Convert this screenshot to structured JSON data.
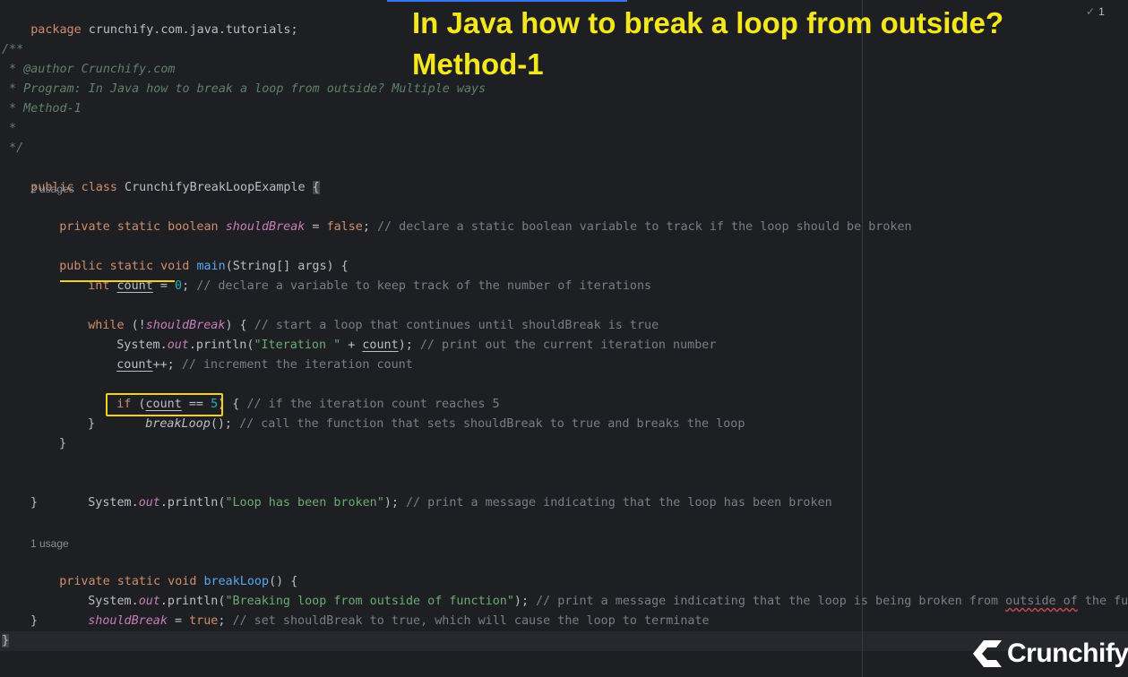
{
  "slide": {
    "title_line1": "In Java how to break a loop from outside?",
    "title_line2": "Method-1"
  },
  "status": {
    "inspection_count": "1"
  },
  "brand": {
    "logo_text": "Crunchify"
  },
  "colors": {
    "background": "#1e1f22",
    "annotation_yellow": "#f2d319",
    "title_yellow": "#f5e71d",
    "keyword": "#cf8e6d",
    "function": "#56a8f5",
    "string": "#6aab73",
    "comment": "#7a7e85"
  },
  "code": {
    "l1": {
      "kw": "package",
      "text": " crunchify.com.java.tutorials;"
    },
    "l3": "/**",
    "l4": {
      "pre": " * ",
      "tag": "@author",
      "rest": " Crunchify.com"
    },
    "l5": " * Program: In Java how to break a loop from outside? Multiple ways",
    "l6": " * Method-1",
    "l7": " *",
    "l8": " */",
    "l9": {
      "kw": "public class",
      "name": " CrunchifyBreakLoopExample ",
      "brace": "{"
    },
    "usages_field": "2 usages",
    "l10": {
      "kw": "private static boolean",
      "field": "shouldBreak",
      "eq": " = ",
      "val": "false",
      "semi": "; ",
      "comment": "// declare a static boolean variable to track if the loop should be broken"
    },
    "l12": {
      "kw": "public static void",
      "fn": "main",
      "rest": "(String[] args) {"
    },
    "l13": {
      "kw": "int",
      "var": "count",
      "eq": " = ",
      "num": "0",
      "semi": "; ",
      "comment": "// declare a variable to keep track of the number of iterations"
    },
    "l15": {
      "kw": "while",
      "open": " (!",
      "field": "shouldBreak",
      "close": ") { ",
      "comment": "// start a loop that continues until shouldBreak is true"
    },
    "l16": {
      "sys": "System.",
      "out": "out",
      "call": ".println(",
      "str": "\"Iteration \"",
      "plus": " + ",
      "var": "count",
      "end": "); ",
      "comment": "// print out the current iteration number"
    },
    "l17": {
      "var": "count",
      "op": "++; ",
      "comment": "// increment the iteration count"
    },
    "l19": {
      "kw": "if",
      "open": " (",
      "var": "count",
      "op": " == ",
      "num": "5",
      "close": ") { ",
      "comment": "// if the iteration count reaches 5"
    },
    "l20": {
      "call": "breakLoop",
      "paren": "(); ",
      "comment": "// call the function that sets shouldBreak to true and breaks the loop"
    },
    "l21": "}",
    "l22": "}",
    "l24": {
      "sys": "System.",
      "out": "out",
      "call": ".println(",
      "str": "\"Loop has been broken\"",
      "end": "); ",
      "comment": "// print a message indicating that the loop has been broken"
    },
    "l25": "}",
    "usages_method": "1 usage",
    "l27": {
      "kw": "private static void",
      "fn": "breakLoop",
      "rest": "() {"
    },
    "l28": {
      "sys": "System.",
      "out": "out",
      "call": ".println(",
      "str": "\"Breaking loop from outside of function\"",
      "end": "); ",
      "comment_a": "// print a message indicating that the loop is being broken from ",
      "comment_typo": "outside of",
      "comment_b": " the functio"
    },
    "l29": {
      "field": "shouldBreak",
      "eq": " = ",
      "val": "true",
      "semi": "; ",
      "comment": "// set shouldBreak to true, which will cause the loop to terminate"
    },
    "l30": "}",
    "l31": "}"
  }
}
